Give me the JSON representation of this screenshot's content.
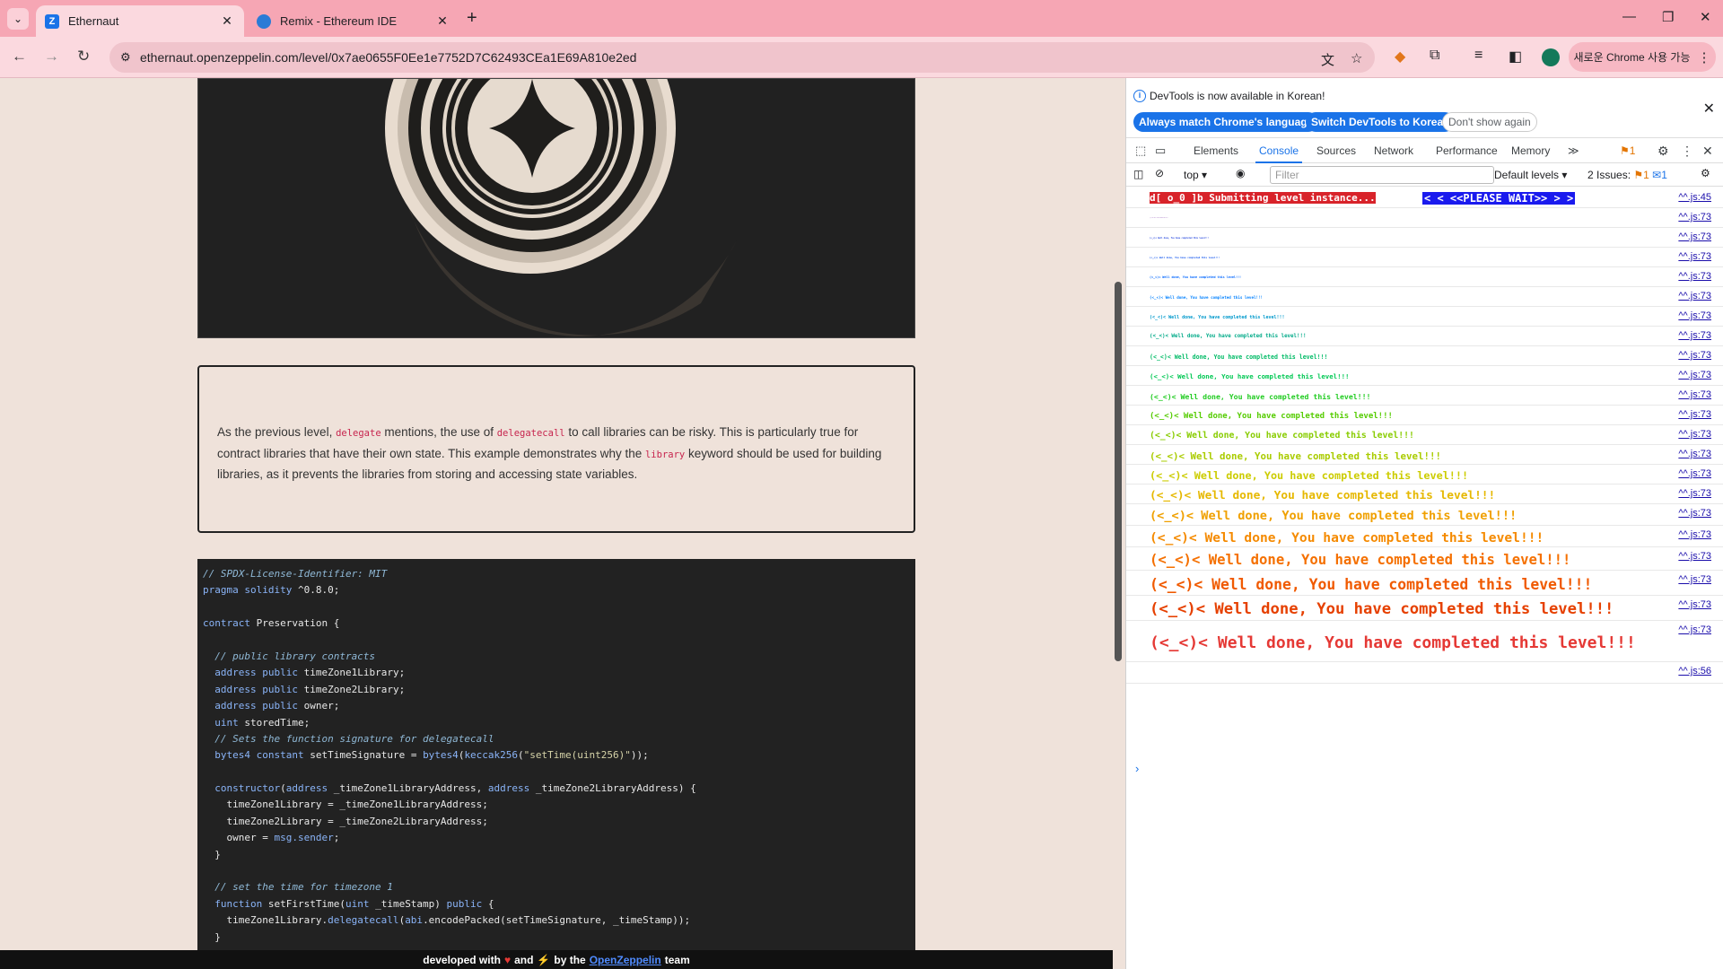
{
  "browser": {
    "tabs": [
      {
        "title": "Ethernaut",
        "active": true,
        "favicon": "Z"
      },
      {
        "title": "Remix - Ethereum IDE",
        "active": false,
        "favicon": "remix-icon"
      }
    ],
    "url": "ethernaut.openzeppelin.com/level/0x7ae0655F0Ee1e7752D7C62493CEa1E69A810e2ed",
    "chrome_promo": "새로운 Chrome 사용 가능"
  },
  "page": {
    "description_parts": [
      "As the previous level, ",
      "delegate",
      " mentions, the use of ",
      "delegatecall",
      " to call libraries can be risky. This is particularly true for contract libraries that have their own state. This example demonstrates why the ",
      "library",
      " keyword should be used for building libraries, as it prevents the libraries from storing and accessing state variables."
    ],
    "code_lines": [
      "// SPDX-License-Identifier: MIT",
      "pragma solidity ^0.8.0;",
      "",
      "contract Preservation {",
      "",
      "  // public library contracts",
      "  address public timeZone1Library;",
      "  address public timeZone2Library;",
      "  address public owner;",
      "  uint storedTime;",
      "  // Sets the function signature for delegatecall",
      "  bytes4 constant setTimeSignature = bytes4(keccak256(\"setTime(uint256)\"));",
      "",
      "  constructor(address _timeZone1LibraryAddress, address _timeZone2LibraryAddress) {",
      "    timeZone1Library = _timeZone1LibraryAddress;",
      "    timeZone2Library = _timeZone2LibraryAddress;",
      "    owner = msg.sender;",
      "  }",
      "",
      "  // set the time for timezone 1",
      "  function setFirstTime(uint _timeStamp) public {",
      "    timeZone1Library.delegatecall(abi.encodePacked(setTimeSignature, _timeStamp));",
      "  }"
    ],
    "footer": {
      "prefix": "developed with",
      "and": "and",
      "by_the": "by the",
      "link": "OpenZeppelin",
      "suffix": "team"
    }
  },
  "devtools": {
    "info_message": "DevTools is now available in Korean!",
    "btn_match": "Always match Chrome's language",
    "btn_switch": "Switch DevTools to Korean",
    "btn_dismiss": "Don't show again",
    "tabs": [
      "Elements",
      "Console",
      "Sources",
      "Network",
      "Performance",
      "Memory"
    ],
    "active_tab": "Console",
    "issues_badge": "1",
    "context": "top",
    "filter_placeholder": "Filter",
    "levels": "Default levels",
    "issues_text": "2 Issues:",
    "issues_warn": "1",
    "issues_info": "1",
    "submit_log": "d[ o_0 ]b Submitting level instance...",
    "please_wait": "<  < <<PLEASE WAIT>> >  >",
    "success_text": "(<_<)< Well done, You have completed this level!!!",
    "sources": [
      "^^.js:45",
      "^^.js:73",
      "^^.js:73",
      "^^.js:73",
      "^^.js:73",
      "^^.js:73",
      "^^.js:73",
      "^^.js:73",
      "^^.js:73",
      "^^.js:73",
      "^^.js:73",
      "^^.js:73",
      "^^.js:73",
      "^^.js:73",
      "^^.js:73",
      "^^.js:73",
      "^^.js:73",
      "^^.js:73",
      "^^.js:73",
      "^^.js:73",
      "^^.js:73",
      "^^.js:73",
      "^^.js:56"
    ],
    "success_colors": [
      "#3333cc",
      "#2244dd",
      "#1155ee",
      "#0066ff",
      "#0080ff",
      "#0099cc",
      "#00aa88",
      "#00bb66",
      "#00c853",
      "#22cc22",
      "#55cc00",
      "#88cc00",
      "#aacc00",
      "#cccc00",
      "#e6b800",
      "#f0a000",
      "#f58a00",
      "#f57000",
      "#f05a00",
      "#e64000"
    ]
  }
}
